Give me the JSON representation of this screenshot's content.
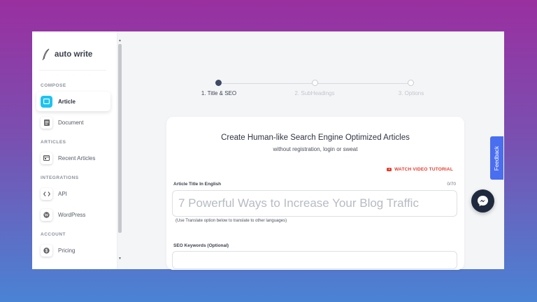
{
  "brand": {
    "name": "auto write",
    "icon": "quill-icon"
  },
  "sidebar": {
    "sections": [
      {
        "label": "COMPOSE"
      },
      {
        "label": "ARTICLES"
      },
      {
        "label": "INTEGRATIONS"
      },
      {
        "label": "ACCOUNT"
      }
    ],
    "items": [
      {
        "label": "Article",
        "icon": "article-icon",
        "active": true
      },
      {
        "label": "Document",
        "icon": "document-icon"
      },
      {
        "label": "Recent Articles",
        "icon": "recent-articles-icon"
      },
      {
        "label": "API",
        "icon": "code-icon"
      },
      {
        "label": "WordPress",
        "icon": "wordpress-icon"
      },
      {
        "label": "Pricing",
        "icon": "dollar-icon"
      }
    ]
  },
  "stepper": {
    "steps": [
      {
        "label": "1. Title & SEO",
        "active": true
      },
      {
        "label": "2. SubHeadings",
        "active": false
      },
      {
        "label": "3. Options",
        "active": false
      }
    ]
  },
  "form": {
    "title": "Create Human-like Search Engine Optimized Articles",
    "subtitle": "without registration, login or sweat",
    "tutorial_label": "WATCH VIDEO TUTORIAL",
    "article_title_label": "Article Title In English",
    "char_count": "0/70",
    "article_title_placeholder": "7 Powerful Ways to Increase Your Blog Traffic",
    "translate_hint": "(Use Translate option below to translate to other languages)",
    "seo_keywords_label": "SEO Keywords (Optional)",
    "seo_keywords_value": ""
  },
  "feedback_label": "Feedback",
  "colors": {
    "accent": "#1ec3f0",
    "feedback": "#4a6ef0",
    "tutorial": "#e43b2c",
    "messenger": "#1f2a3e"
  }
}
